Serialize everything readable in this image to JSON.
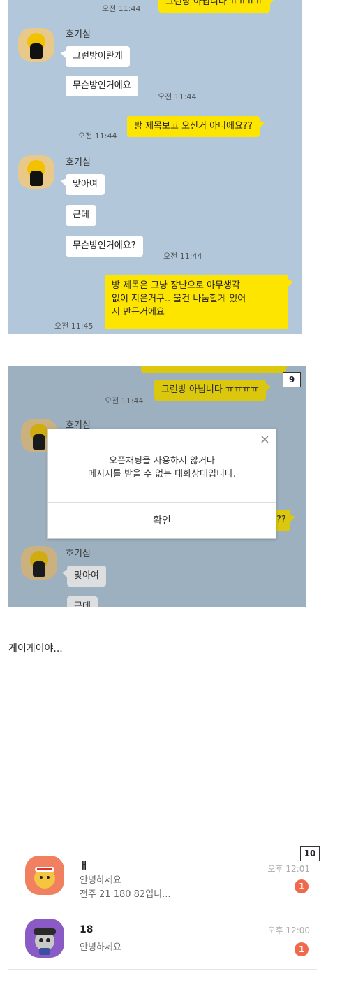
{
  "chat1": {
    "top_bubble": "그런방 아닙니다 ㅠㅠㅠㅠ",
    "top_time": "오전 11:44",
    "group1": {
      "sender": "호기심",
      "msg1": "그런방이란게",
      "msg2": "무슨방인거에요",
      "time": "오전 11:44"
    },
    "my_reply1": {
      "text": "방 제목보고 오신거 아니에요??",
      "time": "오전 11:44"
    },
    "group2": {
      "sender": "호기심",
      "msg1": "맞아여",
      "msg2": "근데",
      "msg3": "무슨방인거에요?",
      "time": "오전 11:44"
    },
    "my_reply2": {
      "line1": "방 제목은 그냥 장난으로 아무생각",
      "line2": "없이 지은거구.. 물건 나눔할게 있어",
      "line3": "서 만든거에요",
      "time": "오전 11:45"
    }
  },
  "chat2": {
    "badge": "9",
    "top_bubble": "그런방 아닙니다 ㅠㅠㅠㅠ",
    "top_time": "오전 11:44",
    "sender1": "호기심",
    "partial_reply": "??",
    "sender2": "호기심",
    "msg1": "맞아여",
    "msg2": "근데",
    "dialog": {
      "line1": "오픈채팅을 사용하지 않거나",
      "line2": "메시지를 받을 수 없는 대화상대입니다.",
      "confirm": "확인",
      "close": "×"
    }
  },
  "caption": "게이게이야...",
  "chat_list": {
    "badge": "10",
    "items": [
      {
        "name": "ㅐ",
        "line1": "안녕하세요",
        "line2": "전주 21 180 82입니...",
        "time": "오후 12:01",
        "unread": "1"
      },
      {
        "name": "18",
        "line1": "안녕하세요",
        "line2": "",
        "time": "오후 12:00",
        "unread": "1"
      }
    ]
  },
  "colors": {
    "chat_bg": "#b2c7d9",
    "my_bubble": "#fee500",
    "other_bubble": "#ffffff",
    "unread_badge": "#ef6a4c"
  }
}
